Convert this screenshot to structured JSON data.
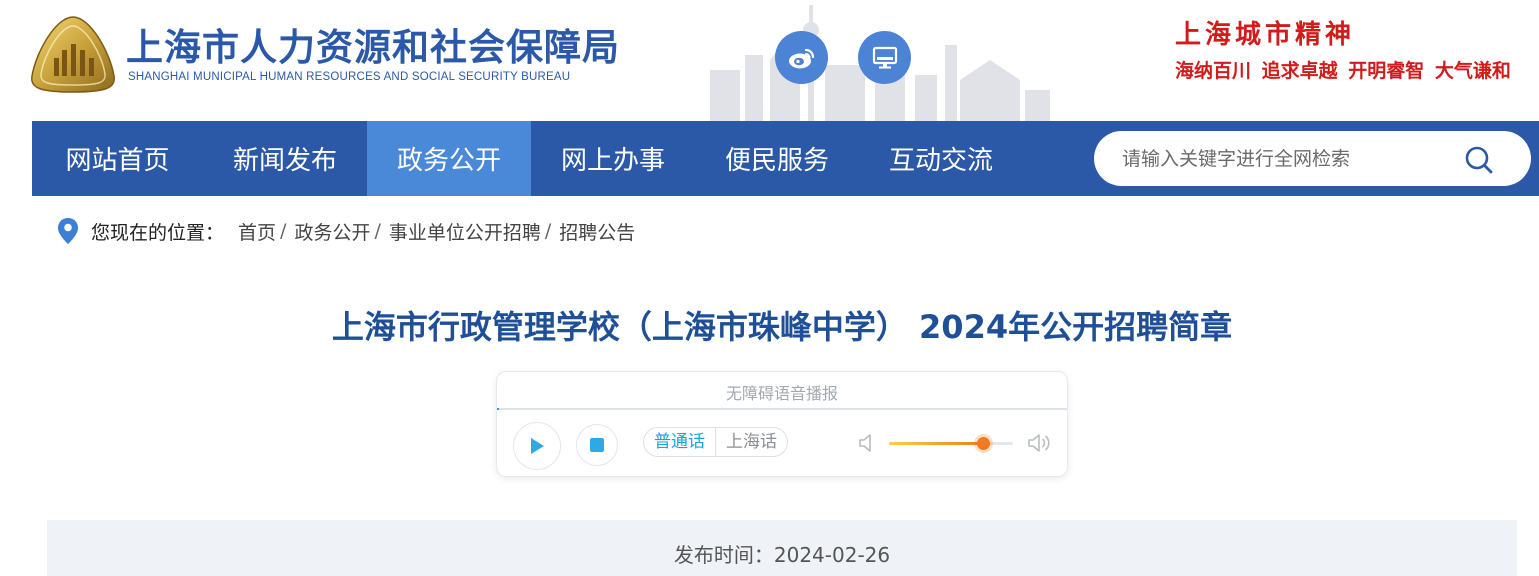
{
  "header": {
    "logo_cn": "上海市人力资源和社会保障局",
    "logo_en": "SHANGHAI MUNICIPAL HUMAN RESOURCES AND SOCIAL SECURITY BUREAU",
    "spirit_title": "上海城市精神",
    "spirit_line": "海纳百川 追求卓越 开明睿智 大气谦和",
    "social_icons": [
      "weibo-icon",
      "desktop-icon"
    ]
  },
  "nav": {
    "items": [
      {
        "label": "网站首页"
      },
      {
        "label": "新闻发布"
      },
      {
        "label": "政务公开",
        "active": true
      },
      {
        "label": "网上办事"
      },
      {
        "label": "便民服务"
      },
      {
        "label": "互动交流"
      }
    ],
    "search_placeholder": "请输入关键字进行全网检索"
  },
  "breadcrumb": {
    "label": "您现在的位置：",
    "items": [
      "首页",
      "政务公开",
      "事业单位公开招聘",
      "招聘公告"
    ],
    "separator": "/"
  },
  "article": {
    "title": "上海市行政管理学校（上海市珠峰中学） 2024年公开招聘简章"
  },
  "player": {
    "title": "无障碍语音播报",
    "dialects": [
      "普通话",
      "上海话"
    ],
    "active_dialect": "普通话",
    "volume_fraction": 0.76,
    "progress_fraction": 0.0
  },
  "publish": {
    "text": "发布时间：2024-02-26"
  },
  "colors": {
    "brand_blue": "#2b59a8",
    "nav_active": "#4a88d8",
    "title_blue": "#1e4f97",
    "spirit_red": "#d11c1c",
    "volume_orange": "#f07a1f"
  }
}
